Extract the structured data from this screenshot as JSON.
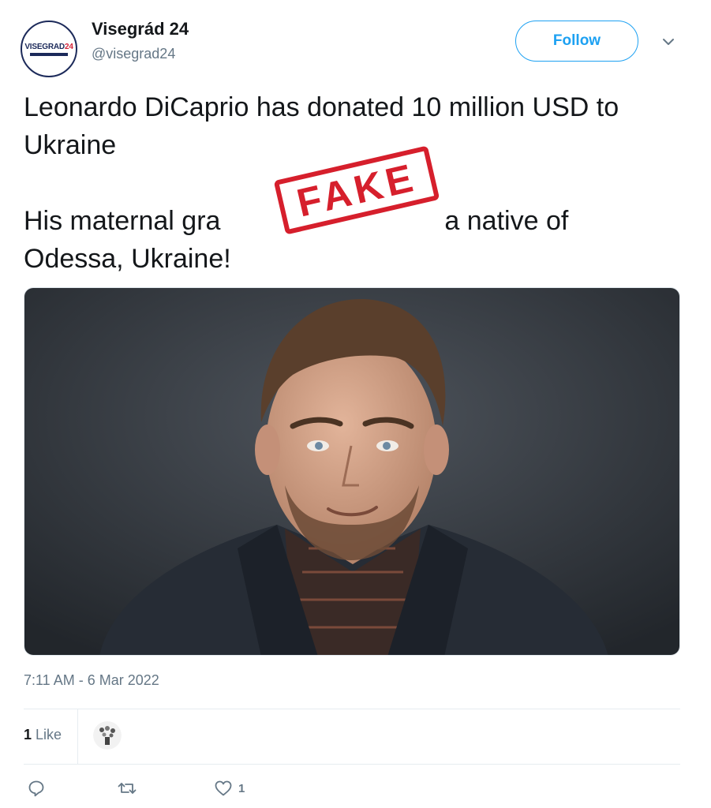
{
  "tweet": {
    "author": {
      "display_name": "Visegrád 24",
      "handle": "@visegrad24",
      "avatar_logo": {
        "text_main": "VISEGRAD",
        "text_accent": "24"
      }
    },
    "follow_label": "Follow",
    "text_lines": [
      "Leonardo DiCaprio has donated 10 million USD to Ukraine",
      "His maternal gra",
      "a native of Odessa, Ukraine!"
    ],
    "stamp_label": "FAKE",
    "timestamp": "7:11 AM - 6 Mar 2022",
    "likes": {
      "count": "1",
      "label": "Like"
    },
    "actions": {
      "reply_icon": "reply-icon",
      "retweet_icon": "retweet-icon",
      "like_icon": "heart-icon",
      "like_count": "1"
    }
  },
  "colors": {
    "link_blue": "#1da1f2",
    "stamp_red": "#d61f2c",
    "secondary_text": "#657786"
  }
}
